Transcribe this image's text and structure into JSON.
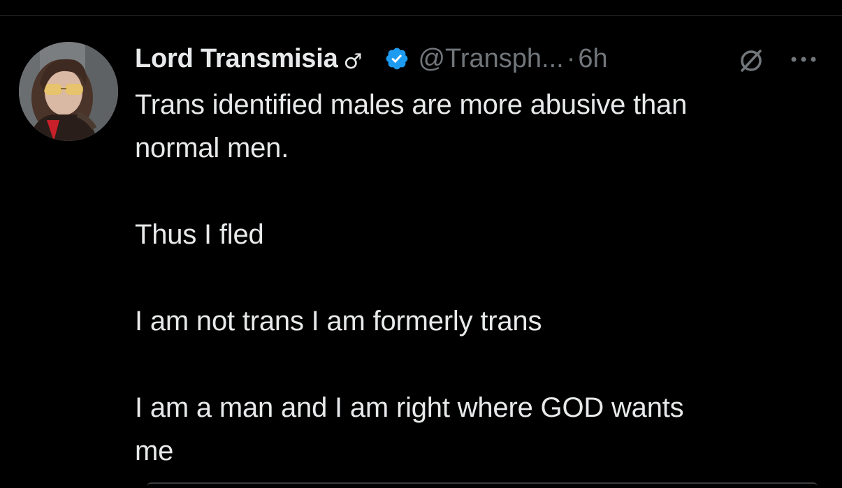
{
  "tweet": {
    "author": {
      "display_name": "Lord Transmisia",
      "name_symbol": "♂",
      "handle": "@Transph...",
      "verified": true,
      "verified_color": "#1d9bf0"
    },
    "separator": "·",
    "time": "6h",
    "icons": {
      "avatar": "profile-photo",
      "verified": "verified-badge-icon",
      "status": "null-circle-icon",
      "more": "more-options-icon"
    },
    "text_lines": [
      "Trans identified males are more abusive than",
      "normal men.",
      "",
      "Thus I fled",
      "",
      "I am not trans I am formerly trans",
      "",
      "I am a man and I am right where GOD wants",
      "me"
    ]
  },
  "colors": {
    "background": "#000000",
    "text_primary": "#e7e9ea",
    "text_secondary": "#71767b",
    "accent": "#1d9bf0"
  }
}
